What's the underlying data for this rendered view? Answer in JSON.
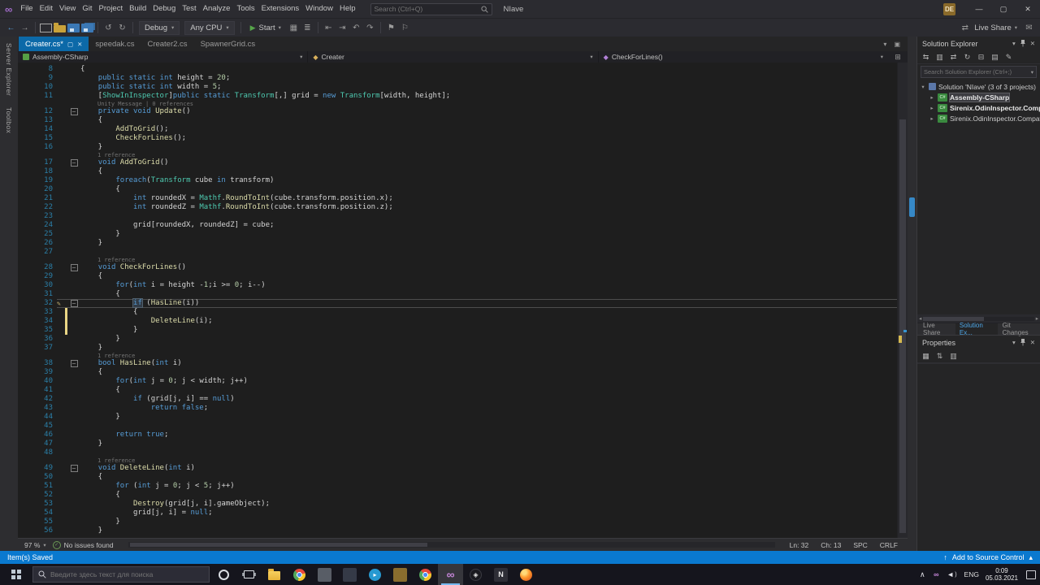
{
  "icons": {
    "infinity": "∞",
    "chevron_down": "▾",
    "minimize": "—",
    "maximize": "▢",
    "close": "✕",
    "play": "▶",
    "check": "✓",
    "pencil": "✎",
    "fold": "–",
    "keep_open": "▢",
    "window": "▣",
    "split": "⊞",
    "up": "↑",
    "caret_up": "▴",
    "left": "◂",
    "right": "▸",
    "share": "⇄",
    "feedback": "✉",
    "expand_collapsed": "▸",
    "expand_open": "▾"
  },
  "titlebar": {
    "menus": [
      "File",
      "Edit",
      "View",
      "Git",
      "Project",
      "Build",
      "Debug",
      "Test",
      "Analyze",
      "Tools",
      "Extensions",
      "Window",
      "Help"
    ],
    "search_placeholder": "Search (Ctrl+Q)",
    "title": "NIave",
    "avatar": "DE"
  },
  "toolbar": {
    "left_icons": [
      {
        "name": "navigate-back-icon",
        "glyph": "←",
        "cls": "blue"
      },
      {
        "name": "navigate-forward-icon",
        "glyph": "→",
        "cls": "dim"
      },
      {
        "name": "separator"
      },
      {
        "name": "new-file-icon",
        "cls": "newfile"
      },
      {
        "name": "open-file-icon",
        "cls": "folderic"
      },
      {
        "name": "save-icon",
        "cls": "floppy"
      },
      {
        "name": "save-all-icon",
        "cls": "floppy all"
      },
      {
        "name": "separator"
      },
      {
        "name": "undo-icon",
        "glyph": "↺",
        "cls": "dim"
      },
      {
        "name": "redo-icon",
        "glyph": "↻",
        "cls": "dim"
      },
      {
        "name": "separator"
      }
    ],
    "config_label": "Debug",
    "platform_label": "Any CPU",
    "start_label": "Start",
    "after_start_icons": [
      {
        "name": "profiler-icon",
        "glyph": "▦",
        "cls": "dim"
      },
      {
        "name": "memory-icon",
        "glyph": "≣",
        "cls": "dim"
      },
      {
        "name": "separator"
      },
      {
        "name": "step-back-icon",
        "glyph": "⇤",
        "cls": "dim"
      },
      {
        "name": "step-forward-icon",
        "glyph": "⇥",
        "cls": "dim"
      },
      {
        "name": "navigate-backward-icon",
        "glyph": "↶",
        "cls": "dim"
      },
      {
        "name": "navigate-forward2-icon",
        "glyph": "↷",
        "cls": "dim"
      },
      {
        "name": "separator"
      },
      {
        "name": "bookmark-icon",
        "glyph": "⚑",
        "cls": "dim"
      },
      {
        "name": "bookmark-clear-icon",
        "glyph": "⚐",
        "cls": "dim"
      }
    ],
    "live_share_label": "Live Share"
  },
  "doc_tabs": [
    {
      "label": "Creater.cs*",
      "active": true
    },
    {
      "label": "speedak.cs"
    },
    {
      "label": "Creater2.cs"
    },
    {
      "label": "SpawnerGrid.cs"
    }
  ],
  "breadcrumb": {
    "project": "Assembly-CSharp",
    "type": "Creater",
    "member": "CheckForLines()"
  },
  "left_dock_tabs": [
    "Server Explorer",
    "Toolbox"
  ],
  "editor": {
    "rows": [
      {
        "n": "8",
        "s": [
          [
            "pl",
            "{"
          ]
        ]
      },
      {
        "n": "9",
        "s": [
          [
            "pl",
            "    "
          ],
          [
            "kw",
            "public static int"
          ],
          [
            "pl",
            " height = "
          ],
          [
            "nu",
            "20"
          ],
          [
            "pl",
            ";"
          ]
        ]
      },
      {
        "n": "10",
        "s": [
          [
            "pl",
            "    "
          ],
          [
            "kw",
            "public static int"
          ],
          [
            "pl",
            " width = "
          ],
          [
            "nu",
            "5"
          ],
          [
            "pl",
            ";"
          ]
        ]
      },
      {
        "n": "11",
        "s": [
          [
            "pl",
            "    ["
          ],
          [
            "ty",
            "ShowInInspector"
          ],
          [
            "pl",
            "]"
          ],
          [
            "kw",
            "public static "
          ],
          [
            "ty",
            "Transform"
          ],
          [
            "pl",
            "[,] grid = "
          ],
          [
            "kw",
            "new "
          ],
          [
            "ty",
            "Transform"
          ],
          [
            "pl",
            "[width, height];"
          ]
        ]
      },
      {
        "lens": "Unity Message | 0 references"
      },
      {
        "n": "12",
        "f": 1,
        "s": [
          [
            "pl",
            "    "
          ],
          [
            "kw",
            "private void "
          ],
          [
            "me",
            "Update"
          ],
          [
            "pl",
            "()"
          ]
        ]
      },
      {
        "n": "13",
        "s": [
          [
            "pl",
            "    {"
          ]
        ]
      },
      {
        "n": "14",
        "s": [
          [
            "pl",
            "        "
          ],
          [
            "me",
            "AddToGrid"
          ],
          [
            "pl",
            "();"
          ]
        ]
      },
      {
        "n": "15",
        "s": [
          [
            "pl",
            "        "
          ],
          [
            "me",
            "CheckForLines"
          ],
          [
            "pl",
            "();"
          ]
        ]
      },
      {
        "n": "16",
        "s": [
          [
            "pl",
            "    }"
          ]
        ]
      },
      {
        "lens": "1 reference"
      },
      {
        "n": "17",
        "f": 1,
        "s": [
          [
            "pl",
            "    "
          ],
          [
            "kw",
            "void "
          ],
          [
            "me",
            "AddToGrid"
          ],
          [
            "pl",
            "()"
          ]
        ]
      },
      {
        "n": "18",
        "s": [
          [
            "pl",
            "    {"
          ]
        ]
      },
      {
        "n": "19",
        "s": [
          [
            "pl",
            "        "
          ],
          [
            "kw",
            "foreach"
          ],
          [
            "pl",
            "("
          ],
          [
            "ty",
            "Transform"
          ],
          [
            "pl",
            " cube "
          ],
          [
            "kw",
            "in"
          ],
          [
            "pl",
            " transform)"
          ]
        ]
      },
      {
        "n": "20",
        "s": [
          [
            "pl",
            "        {"
          ]
        ]
      },
      {
        "n": "21",
        "s": [
          [
            "pl",
            "            "
          ],
          [
            "kw",
            "int"
          ],
          [
            "pl",
            " roundedX = "
          ],
          [
            "ty",
            "Mathf"
          ],
          [
            "pl",
            "."
          ],
          [
            "me",
            "RoundToInt"
          ],
          [
            "pl",
            "(cube.transform.position.x);"
          ]
        ]
      },
      {
        "n": "22",
        "s": [
          [
            "pl",
            "            "
          ],
          [
            "kw",
            "int"
          ],
          [
            "pl",
            " roundedZ = "
          ],
          [
            "ty",
            "Mathf"
          ],
          [
            "pl",
            "."
          ],
          [
            "me",
            "RoundToInt"
          ],
          [
            "pl",
            "(cube.transform.position.z);"
          ]
        ]
      },
      {
        "n": "23",
        "s": []
      },
      {
        "n": "24",
        "s": [
          [
            "pl",
            "            grid[roundedX, roundedZ] = cube;"
          ]
        ]
      },
      {
        "n": "25",
        "s": [
          [
            "pl",
            "        }"
          ]
        ]
      },
      {
        "n": "26",
        "s": [
          [
            "pl",
            "    }"
          ]
        ]
      },
      {
        "n": "27",
        "s": []
      },
      {
        "lens": "1 reference"
      },
      {
        "n": "28",
        "f": 1,
        "s": [
          [
            "pl",
            "    "
          ],
          [
            "kw",
            "void "
          ],
          [
            "me",
            "CheckForLines"
          ],
          [
            "pl",
            "()"
          ]
        ]
      },
      {
        "n": "29",
        "s": [
          [
            "pl",
            "    {"
          ]
        ]
      },
      {
        "n": "30",
        "s": [
          [
            "pl",
            "        "
          ],
          [
            "kw",
            "for"
          ],
          [
            "pl",
            "("
          ],
          [
            "kw",
            "int"
          ],
          [
            "pl",
            " i = height -"
          ],
          [
            "nu",
            "1"
          ],
          [
            "pl",
            ";i >= "
          ],
          [
            "nu",
            "0"
          ],
          [
            "pl",
            "; i--)"
          ]
        ]
      },
      {
        "n": "31",
        "s": [
          [
            "pl",
            "        {"
          ]
        ]
      },
      {
        "n": "32",
        "f": 1,
        "cur": 1,
        "g": 1,
        "s": [
          [
            "pl",
            "            "
          ],
          [
            "kw sel",
            "if"
          ],
          [
            "pl",
            " ("
          ],
          [
            "me",
            "HasLine"
          ],
          [
            "pl",
            "(i))"
          ]
        ]
      },
      {
        "n": "33",
        "c": 1,
        "s": [
          [
            "pl",
            "            {"
          ]
        ]
      },
      {
        "n": "34",
        "c": 1,
        "s": [
          [
            "pl",
            "                "
          ],
          [
            "me",
            "DeleteLine"
          ],
          [
            "pl",
            "(i);"
          ]
        ]
      },
      {
        "n": "35",
        "c": 1,
        "s": [
          [
            "pl",
            "            }"
          ]
        ]
      },
      {
        "n": "36",
        "s": [
          [
            "pl",
            "        }"
          ]
        ]
      },
      {
        "n": "37",
        "s": [
          [
            "pl",
            "    }"
          ]
        ]
      },
      {
        "lens": "1 reference"
      },
      {
        "n": "38",
        "f": 1,
        "s": [
          [
            "pl",
            "    "
          ],
          [
            "kw",
            "bool "
          ],
          [
            "me",
            "HasLine"
          ],
          [
            "pl",
            "("
          ],
          [
            "kw",
            "int"
          ],
          [
            "pl",
            " i)"
          ]
        ]
      },
      {
        "n": "39",
        "s": [
          [
            "pl",
            "    {"
          ]
        ]
      },
      {
        "n": "40",
        "s": [
          [
            "pl",
            "        "
          ],
          [
            "kw",
            "for"
          ],
          [
            "pl",
            "("
          ],
          [
            "kw",
            "int"
          ],
          [
            "pl",
            " j = "
          ],
          [
            "nu",
            "0"
          ],
          [
            "pl",
            "; j < width; j++)"
          ]
        ]
      },
      {
        "n": "41",
        "s": [
          [
            "pl",
            "        {"
          ]
        ]
      },
      {
        "n": "42",
        "s": [
          [
            "pl",
            "            "
          ],
          [
            "kw",
            "if"
          ],
          [
            "pl",
            " (grid[j, i] == "
          ],
          [
            "kw",
            "null"
          ],
          [
            "pl",
            ")"
          ]
        ]
      },
      {
        "n": "43",
        "s": [
          [
            "pl",
            "                "
          ],
          [
            "kw",
            "return false"
          ],
          [
            "pl",
            ";"
          ]
        ]
      },
      {
        "n": "44",
        "s": [
          [
            "pl",
            "        }"
          ]
        ]
      },
      {
        "n": "45",
        "s": []
      },
      {
        "n": "46",
        "s": [
          [
            "pl",
            "        "
          ],
          [
            "kw",
            "return true"
          ],
          [
            "pl",
            ";"
          ]
        ]
      },
      {
        "n": "47",
        "s": [
          [
            "pl",
            "    }"
          ]
        ]
      },
      {
        "n": "48",
        "s": []
      },
      {
        "lens": "1 reference"
      },
      {
        "n": "49",
        "f": 1,
        "s": [
          [
            "pl",
            "    "
          ],
          [
            "kw",
            "void "
          ],
          [
            "me",
            "DeleteLine"
          ],
          [
            "pl",
            "("
          ],
          [
            "kw",
            "int"
          ],
          [
            "pl",
            " i)"
          ]
        ]
      },
      {
        "n": "50",
        "s": [
          [
            "pl",
            "    {"
          ]
        ]
      },
      {
        "n": "51",
        "s": [
          [
            "pl",
            "        "
          ],
          [
            "kw",
            "for"
          ],
          [
            "pl",
            " ("
          ],
          [
            "kw",
            "int"
          ],
          [
            "pl",
            " j = "
          ],
          [
            "nu",
            "0"
          ],
          [
            "pl",
            "; j < "
          ],
          [
            "nu",
            "5"
          ],
          [
            "pl",
            "; j++)"
          ]
        ]
      },
      {
        "n": "52",
        "s": [
          [
            "pl",
            "        {"
          ]
        ]
      },
      {
        "n": "53",
        "s": [
          [
            "pl",
            "            "
          ],
          [
            "me",
            "Destroy"
          ],
          [
            "pl",
            "(grid[j, i].gameObject);"
          ]
        ]
      },
      {
        "n": "54",
        "s": [
          [
            "pl",
            "            grid[j, i] = "
          ],
          [
            "kw",
            "null"
          ],
          [
            "pl",
            ";"
          ]
        ]
      },
      {
        "n": "55",
        "s": [
          [
            "pl",
            "        }"
          ]
        ]
      },
      {
        "n": "56",
        "s": [
          [
            "pl",
            "    }"
          ]
        ]
      }
    ]
  },
  "solution_explorer": {
    "title": "Solution Explorer",
    "search_placeholder": "Search Solution Explorer (Ctrl+;)",
    "project_icon_text": "C#",
    "toolbar_icons": [
      {
        "name": "switch-views-icon",
        "glyph": "⇆"
      },
      {
        "name": "pending-changes-filter-icon",
        "glyph": "▥"
      },
      {
        "name": "sync-with-active-document-icon",
        "glyph": "⇄"
      },
      {
        "name": "refresh-icon",
        "glyph": "↻"
      },
      {
        "name": "collapse-all-icon",
        "glyph": "⊟"
      },
      {
        "name": "show-all-files-icon",
        "glyph": "▤"
      },
      {
        "name": "properties-icon",
        "glyph": "✎"
      }
    ],
    "items": [
      {
        "label": "Solution 'NIave' (3 of 3 projects)",
        "icon": "solution",
        "indent": 0,
        "expanded": true
      },
      {
        "label": "Assembly-CSharp",
        "icon": "csproj",
        "indent": 1,
        "bold": true,
        "selected": true
      },
      {
        "label": "Sirenix.OdinInspector.Compatib",
        "icon": "csproj",
        "indent": 1,
        "bold": true
      },
      {
        "label": "Sirenix.OdinInspector.Compatibi",
        "icon": "csproj",
        "indent": 1
      }
    ],
    "bottom_tabs": [
      {
        "label": "Live Share"
      },
      {
        "label": "Solution Ex...",
        "active": true
      },
      {
        "label": "Git Changes"
      }
    ]
  },
  "properties_panel": {
    "title": "Properties",
    "toolbar_icons": [
      {
        "name": "categorized-icon",
        "glyph": "▦"
      },
      {
        "name": "alphabetical-icon",
        "glyph": "⇅"
      },
      {
        "name": "property-pages-icon",
        "glyph": "▥"
      }
    ]
  },
  "editor_status": {
    "zoom": "97 %",
    "issues": "No issues found",
    "line": "Ln: 32",
    "column": "Ch: 13",
    "spaces": "SPC",
    "line_ending": "CRLF"
  },
  "status_bar": {
    "message": "Item(s) Saved",
    "source_control": "Add to Source Control"
  },
  "taskbar": {
    "search_placeholder": "Введите здесь текст для поиска",
    "apps": [
      {
        "name": "cortana-icon",
        "type": "cortana"
      },
      {
        "name": "task-view-icon",
        "type": "taskview"
      },
      {
        "name": "file-explorer-icon",
        "type": "folder"
      },
      {
        "name": "chrome-icon",
        "type": "chrome"
      },
      {
        "name": "app-icon-1",
        "type": "gray"
      },
      {
        "name": "app-icon-2",
        "type": "darkslate"
      },
      {
        "name": "telegram-icon",
        "type": "telegram",
        "glyph": "▸"
      },
      {
        "name": "app-icon-3",
        "type": "gold"
      },
      {
        "name": "chrome-icon-2",
        "type": "chrome"
      },
      {
        "name": "visual-studio-icon",
        "type": "vs",
        "glyph": "∞",
        "active": true
      },
      {
        "name": "unity-icon",
        "type": "unity",
        "glyph": "◈"
      },
      {
        "name": "app-icon-4",
        "type": "n",
        "glyph": "N"
      },
      {
        "name": "firefox-icon",
        "type": "firefox"
      }
    ],
    "tray_icons": [
      {
        "name": "hidden-icons-chevron",
        "glyph": "∧"
      },
      {
        "name": "vs-tray-icon",
        "glyph": "∞",
        "cls": "vsy"
      },
      {
        "name": "volume-icon",
        "glyph": "◄",
        "cls": "vol"
      }
    ],
    "language": "ENG",
    "time": "0:09",
    "date": "05.03.2021"
  }
}
